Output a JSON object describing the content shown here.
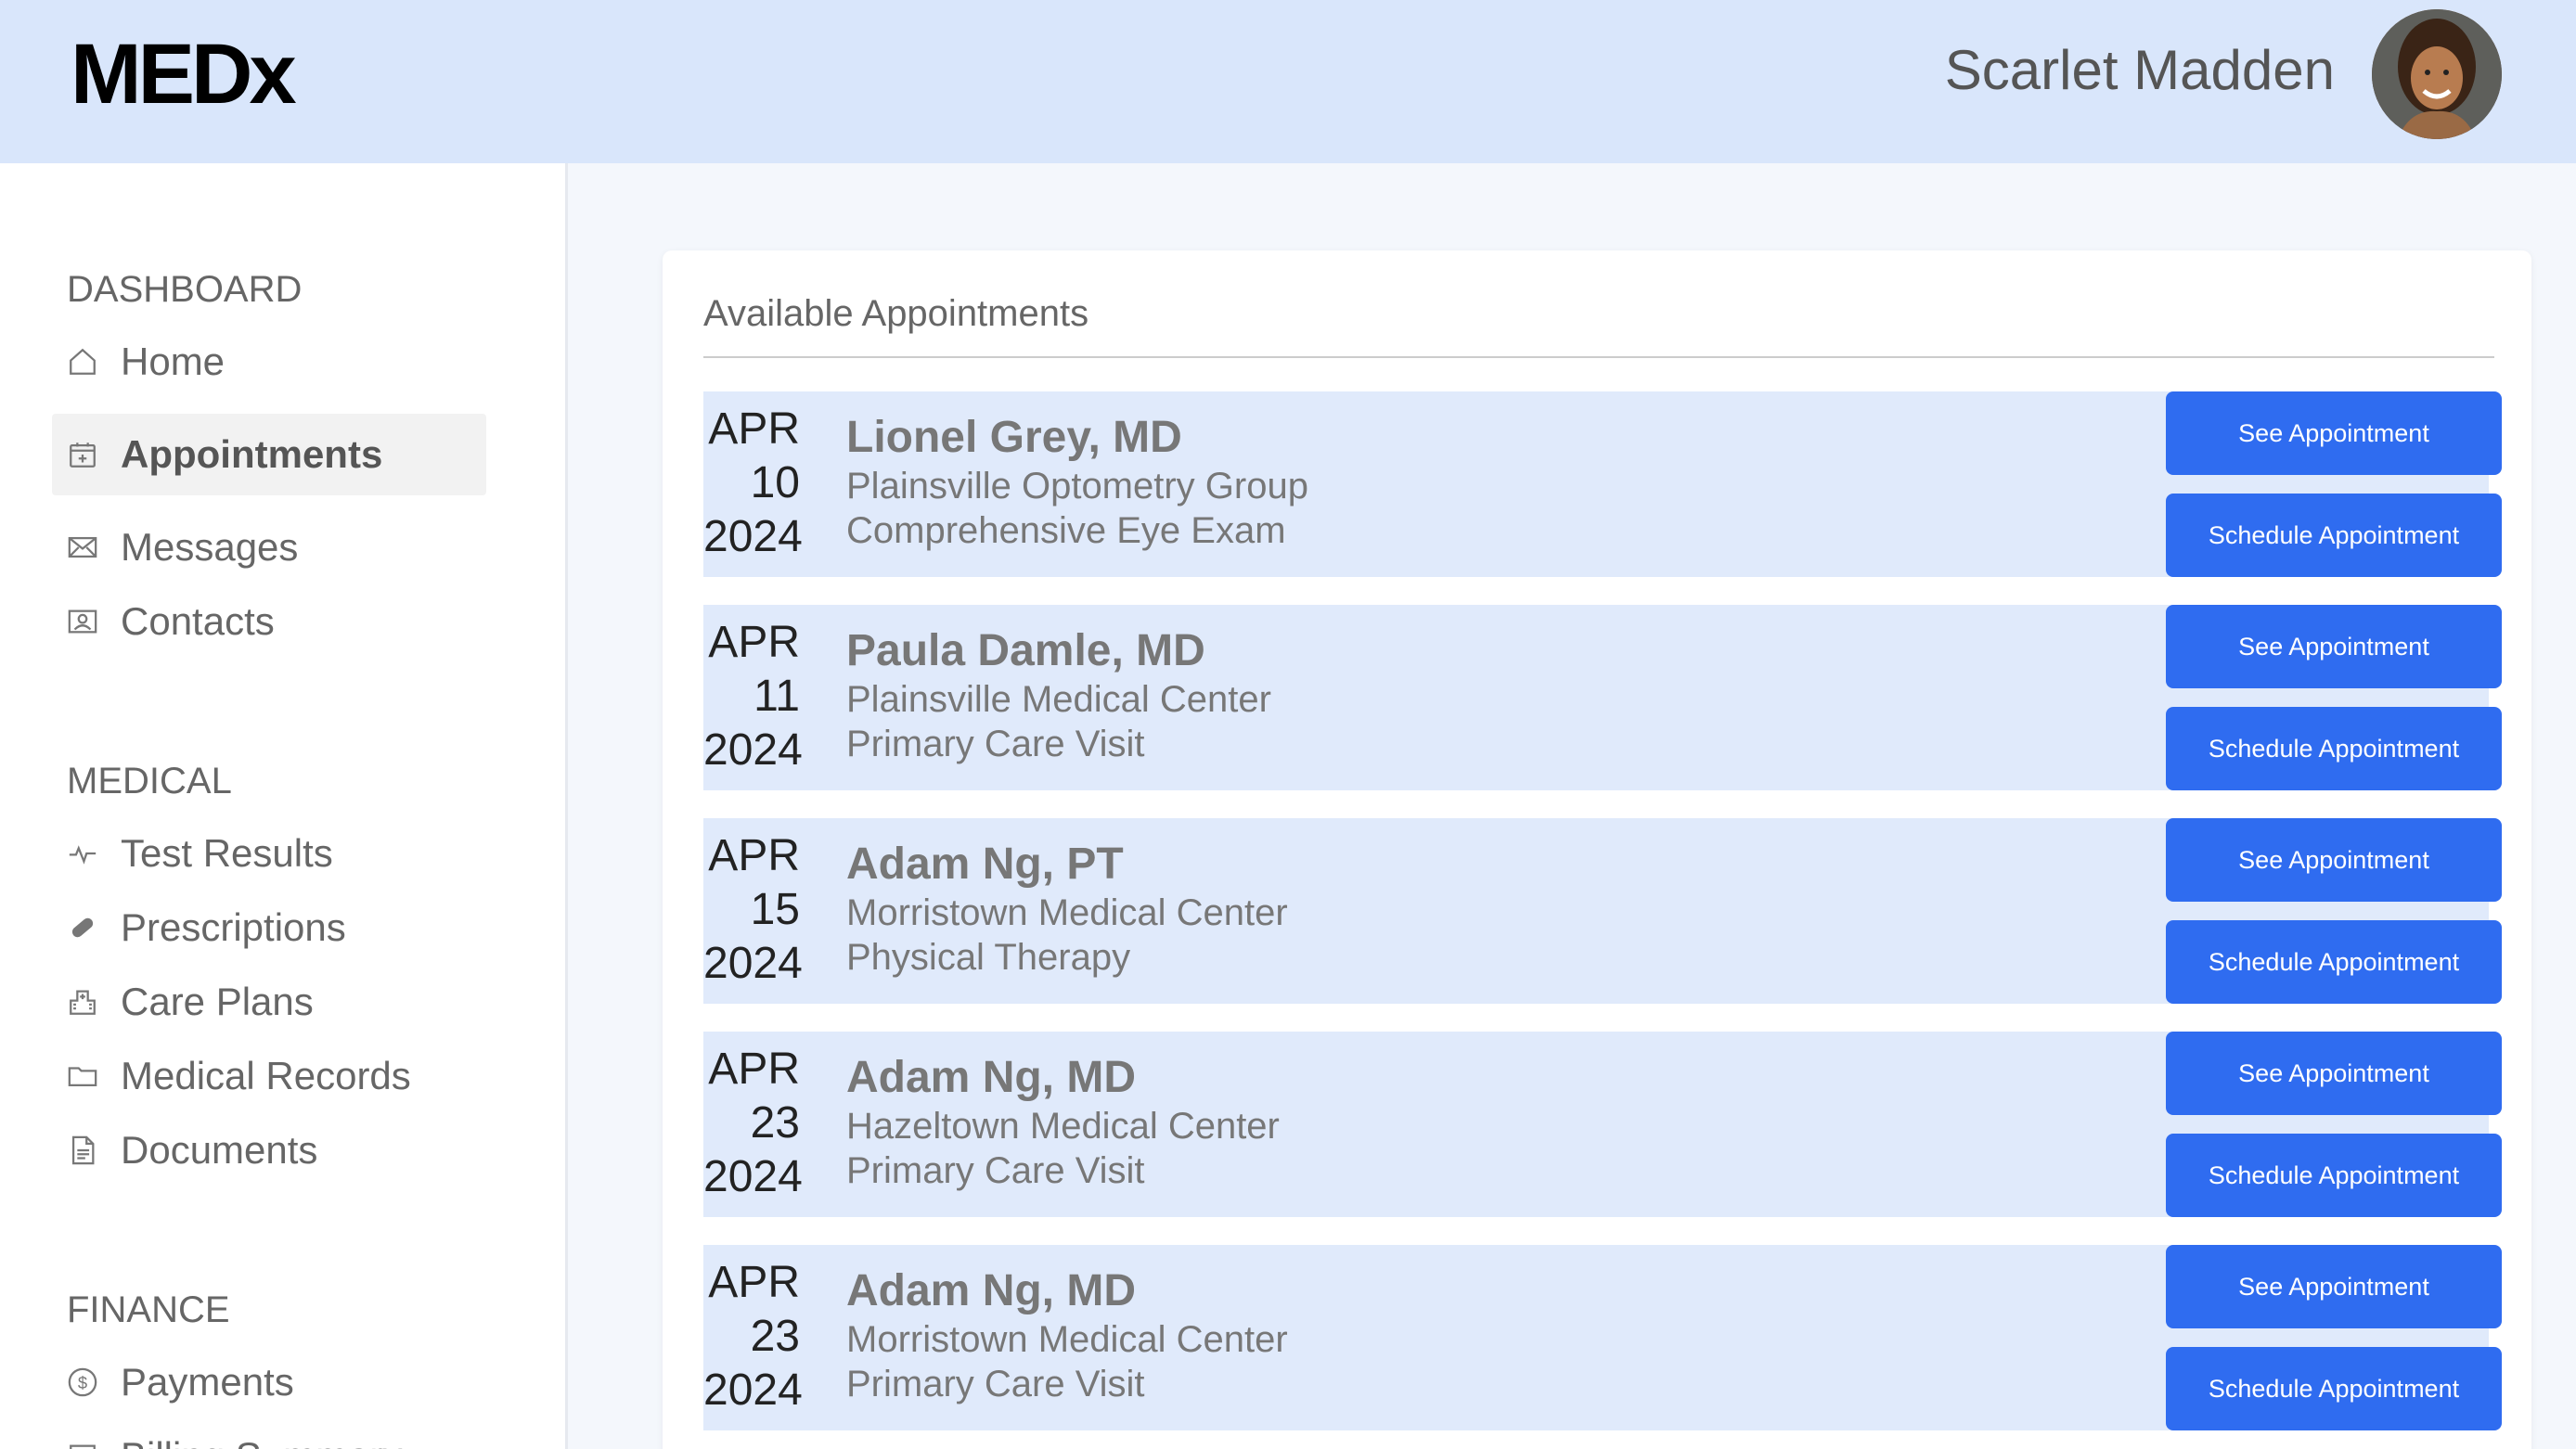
{
  "header": {
    "logo": "MEDx",
    "user_name": "Scarlet Madden"
  },
  "sidebar": {
    "sections": [
      {
        "title": "DASHBOARD",
        "items": [
          {
            "label": "Home",
            "icon": "home-icon"
          },
          {
            "label": "Appointments",
            "icon": "calendar-icon",
            "active": true
          },
          {
            "label": "Messages",
            "icon": "envelope-icon"
          },
          {
            "label": "Contacts",
            "icon": "contact-card-icon"
          }
        ]
      },
      {
        "title": "MEDICAL",
        "items": [
          {
            "label": "Test Results",
            "icon": "pulse-icon"
          },
          {
            "label": "Prescriptions",
            "icon": "pill-icon"
          },
          {
            "label": "Care Plans",
            "icon": "hospital-icon"
          },
          {
            "label": "Medical Records",
            "icon": "folder-icon"
          },
          {
            "label": "Documents",
            "icon": "document-icon"
          }
        ]
      },
      {
        "title": "FINANCE",
        "items": [
          {
            "label": "Payments",
            "icon": "dollar-coin-icon"
          },
          {
            "label": "Billing Summary",
            "icon": "receipt-icon"
          }
        ]
      }
    ]
  },
  "main": {
    "title": "Available Appointments",
    "see_label": "See Appointment",
    "schedule_label": "Schedule Appointment",
    "appointments": [
      {
        "month": "APR",
        "day": "10",
        "year": "2024",
        "doctor": "Lionel Grey, MD",
        "facility": "Plainsville Optometry Group",
        "visit": "Comprehensive Eye Exam"
      },
      {
        "month": "APR",
        "day": "11",
        "year": "2024",
        "doctor": "Paula Damle, MD",
        "facility": "Plainsville Medical Center",
        "visit": "Primary Care Visit"
      },
      {
        "month": "APR",
        "day": "15",
        "year": "2024",
        "doctor": "Adam Ng, PT",
        "facility": "Morristown Medical Center",
        "visit": "Physical Therapy"
      },
      {
        "month": "APR",
        "day": "23",
        "year": "2024",
        "doctor": "Adam Ng, MD",
        "facility": "Hazeltown Medical Center",
        "visit": "Primary Care Visit"
      },
      {
        "month": "APR",
        "day": "23",
        "year": "2024",
        "doctor": "Adam Ng, MD",
        "facility": "Morristown Medical Center",
        "visit": "Primary Care Visit"
      }
    ]
  },
  "colors": {
    "header_bg": "#d9e6fb",
    "row_bg": "#e0eafb",
    "button": "#2f6cf0"
  }
}
